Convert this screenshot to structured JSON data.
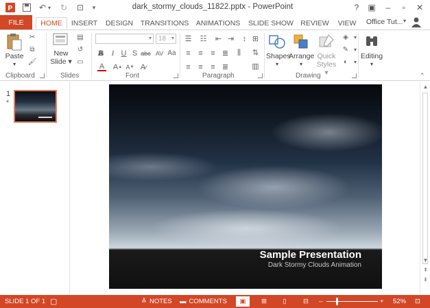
{
  "window": {
    "title": "dark_stormy_clouds_11822.pptx - PowerPoint",
    "help_label": "?"
  },
  "tabs": [
    {
      "label": "FILE"
    },
    {
      "label": "HOME"
    },
    {
      "label": "INSERT"
    },
    {
      "label": "DESIGN"
    },
    {
      "label": "TRANSITIONS"
    },
    {
      "label": "ANIMATIONS"
    },
    {
      "label": "SLIDE SHOW"
    },
    {
      "label": "REVIEW"
    },
    {
      "label": "VIEW"
    }
  ],
  "account": {
    "label": "Office Tut..."
  },
  "ribbon": {
    "clipboard": {
      "paste": "Paste",
      "group": "Clipboard"
    },
    "slides": {
      "new_slide_line1": "New",
      "new_slide_line2": "Slide",
      "group": "Slides"
    },
    "font": {
      "size": "18",
      "group": "Font"
    },
    "paragraph": {
      "group": "Paragraph"
    },
    "drawing": {
      "shapes": "Shapes",
      "arrange": "Arrange",
      "quick_styles_line1": "Quick",
      "quick_styles_line2": "Styles",
      "group": "Drawing"
    },
    "editing": {
      "label": "Editing"
    }
  },
  "thumbnails": {
    "number": "1",
    "star": "*"
  },
  "slide": {
    "title": "Sample Presentation",
    "subtitle": "Dark Stormy Clouds Animation"
  },
  "status": {
    "slide_info": "SLIDE 1 OF 1",
    "notes": "NOTES",
    "comments": "COMMENTS",
    "zoom": "52%"
  },
  "colors": {
    "accent": "#d24726",
    "thumbnail_border": "#e47d5a"
  }
}
